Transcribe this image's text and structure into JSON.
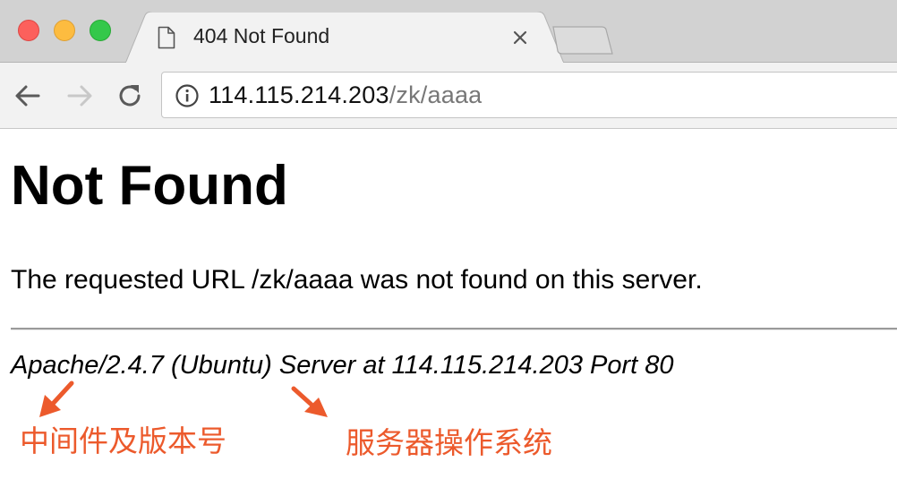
{
  "window": {
    "controls": [
      "close",
      "minimize",
      "maximize"
    ]
  },
  "tab": {
    "title": "404 Not Found",
    "icon": "document-icon",
    "close_icon": "close-icon"
  },
  "toolbar": {
    "back_icon": "back-arrow-icon",
    "forward_icon": "forward-arrow-icon",
    "reload_icon": "reload-icon",
    "address": {
      "info_icon": "info-icon",
      "host": "114.115.214.203",
      "path": "/zk/aaaa"
    }
  },
  "page": {
    "heading": "Not Found",
    "message": "The requested URL /zk/aaaa was not found on this server.",
    "signature": "Apache/2.4.7 (Ubuntu) Server at 114.115.214.203 Port 80"
  },
  "annotations": {
    "color": "#ec5a2c",
    "middleware_label": "中间件及版本号",
    "os_label": "服务器操作系统"
  }
}
